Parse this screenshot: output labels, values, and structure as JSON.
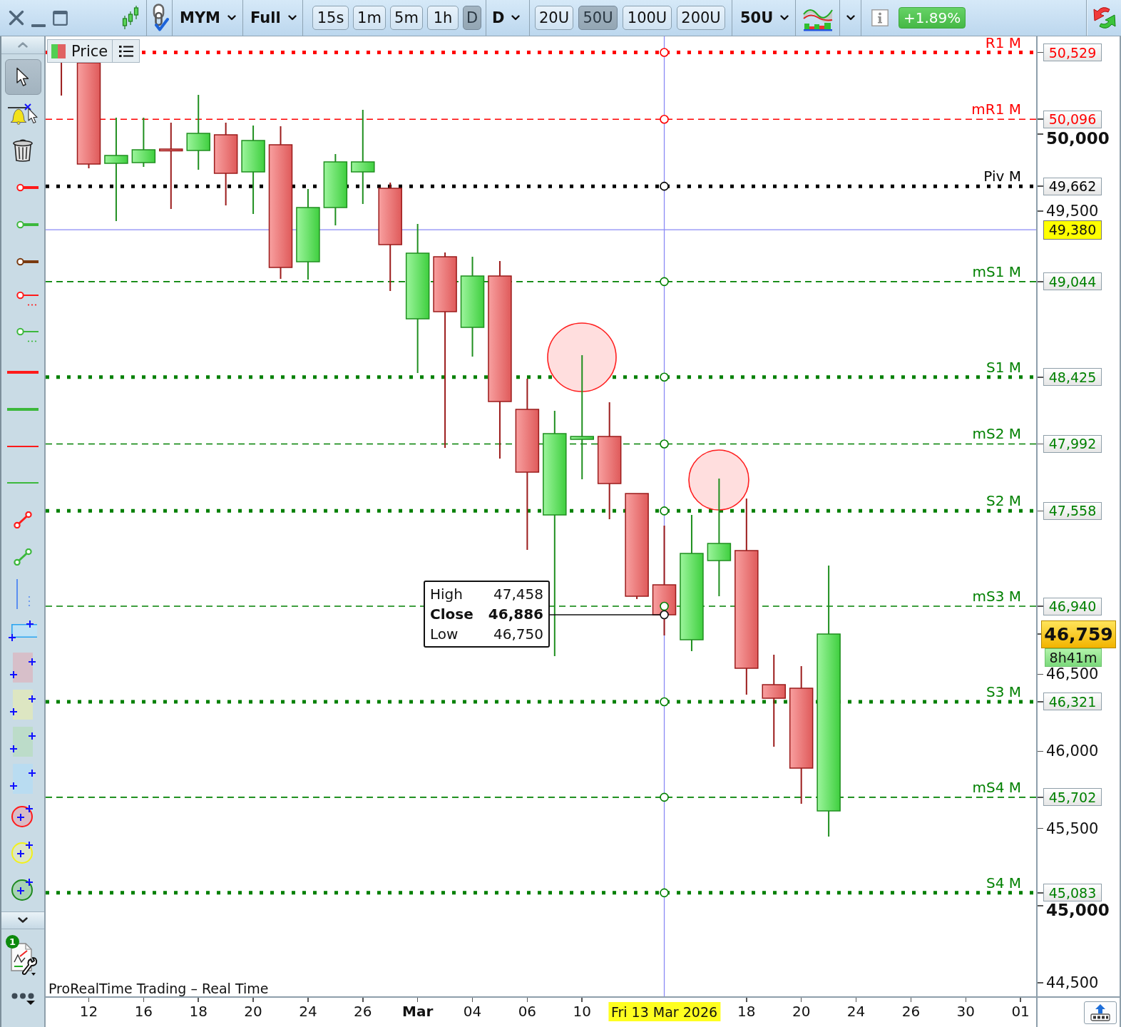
{
  "toolbar": {
    "symbol": "MYM",
    "range": "Full",
    "intervals": [
      {
        "label": "15s",
        "selected": false
      },
      {
        "label": "1m",
        "selected": false
      },
      {
        "label": "5m",
        "selected": false
      },
      {
        "label": "1h",
        "selected": false
      },
      {
        "label": "D",
        "selected": true
      }
    ],
    "period": "D",
    "units": [
      {
        "label": "20U",
        "selected": false
      },
      {
        "label": "50U",
        "selected": true
      },
      {
        "label": "100U",
        "selected": false
      },
      {
        "label": "200U",
        "selected": false
      }
    ],
    "unit": "50U",
    "change": "+1.89%"
  },
  "sidebar": {
    "tools": [
      {
        "selected": true
      },
      {
        "selected": false
      },
      {
        "selected": false
      },
      {
        "selected": false
      },
      {
        "selected": false
      },
      {
        "selected": false
      },
      {
        "selected": false
      },
      {
        "selected": false
      },
      {
        "selected": false
      },
      {
        "selected": false
      },
      {
        "selected": false
      },
      {
        "selected": false
      },
      {
        "selected": false
      },
      {
        "selected": false
      },
      {
        "selected": false
      },
      {
        "selected": false
      },
      {
        "selected": false
      },
      {
        "selected": false
      },
      {
        "selected": false
      },
      {
        "selected": false
      },
      {
        "selected": false
      },
      {
        "selected": false
      },
      {
        "selected": false
      }
    ],
    "settings_badge": "1"
  },
  "chart": {
    "legend": "Price",
    "levels": [
      {
        "label": "R1 M",
        "value": "50,529",
        "color": "#ff0000",
        "kind": "dotted"
      },
      {
        "label": "mR1 M",
        "value": "50,096",
        "color": "#ff0000",
        "kind": "dashed"
      },
      {
        "label": "Piv M",
        "value": "49,662",
        "color": "#000000",
        "kind": "dotted"
      },
      {
        "label": "mS1 M",
        "value": "49,044",
        "color": "#008000",
        "kind": "dashed"
      },
      {
        "label": "S1 M",
        "value": "48,425",
        "color": "#008000",
        "kind": "dotted"
      },
      {
        "label": "mS2 M",
        "value": "47,992",
        "color": "#008000",
        "kind": "dashed"
      },
      {
        "label": "S2 M",
        "value": "47,558",
        "color": "#008000",
        "kind": "dotted"
      },
      {
        "label": "mS3 M",
        "value": "46,940",
        "color": "#008000",
        "kind": "dashed"
      },
      {
        "label": "S3 M",
        "value": "46,321",
        "color": "#008000",
        "kind": "dotted"
      },
      {
        "label": "mS4 M",
        "value": "45,702",
        "color": "#008000",
        "kind": "dashed"
      },
      {
        "label": "S4 M",
        "value": "45,083",
        "color": "#008000",
        "kind": "dotted"
      }
    ],
    "crosshair": {
      "price": "49,380",
      "date": "Fri 13 Mar 2026"
    },
    "tooltip": [
      {
        "label": "High",
        "value": "47,458",
        "highlighted": false
      },
      {
        "label": "Close",
        "value": "46,886",
        "highlighted": true
      },
      {
        "label": "Low",
        "value": "46,750",
        "highlighted": false
      }
    ],
    "last": {
      "price": "46,759",
      "countdown": "8h41m"
    },
    "y_ticks": [
      {
        "label": "50,000",
        "kind": "major"
      },
      {
        "label": "49,500",
        "kind": "minor"
      },
      {
        "label": "46,500",
        "kind": "minor"
      },
      {
        "label": "46,000",
        "kind": "minor"
      },
      {
        "label": "45,500",
        "kind": "minor"
      },
      {
        "label": "45,000",
        "kind": "major"
      },
      {
        "label": "44,500",
        "kind": "minor"
      }
    ],
    "x_labels": [
      {
        "label": "12",
        "kind": "day"
      },
      {
        "label": "16",
        "kind": "day"
      },
      {
        "label": "18",
        "kind": "day"
      },
      {
        "label": "20",
        "kind": "day"
      },
      {
        "label": "24",
        "kind": "day"
      },
      {
        "label": "26",
        "kind": "day"
      },
      {
        "label": "Mar",
        "kind": "month"
      },
      {
        "label": "04",
        "kind": "day"
      },
      {
        "label": "06",
        "kind": "day"
      },
      {
        "label": "10",
        "kind": "day"
      },
      {
        "label": "18",
        "kind": "day"
      },
      {
        "label": "20",
        "kind": "day"
      },
      {
        "label": "24",
        "kind": "day"
      },
      {
        "label": "26",
        "kind": "day"
      },
      {
        "label": "30",
        "kind": "day"
      },
      {
        "label": "01",
        "kind": "day"
      }
    ],
    "footer": "ProRealTime Trading – Real Time"
  }
}
